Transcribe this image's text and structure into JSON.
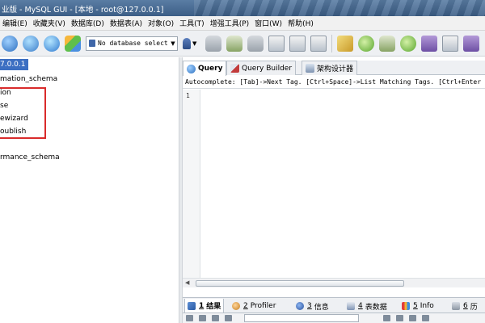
{
  "window": {
    "title": "业版 - MySQL GUI - [本地 - root@127.0.0.1]"
  },
  "menu": {
    "items": [
      "编辑(E)",
      "收藏夹(V)",
      "数据库(D)",
      "数据表(A)",
      "对象(O)",
      "工具(T)",
      "增强工具(P)",
      "窗口(W)",
      "帮助(H)"
    ]
  },
  "toolbar": {
    "database_select": "No database select"
  },
  "tree": {
    "root_label": "7.0.0.1",
    "items": [
      "mation_schema",
      "ion",
      "se",
      "ewizard",
      "oublish",
      "rmance_schema"
    ],
    "highlight_color": "#d92b2b",
    "selection_color": "#3c6fc2"
  },
  "editor": {
    "tabs": [
      "Query",
      "Query Builder",
      "架构设计器"
    ],
    "autocomplete_hint": "Autocomplete: [Tab]->Next Tag. [Ctrl+Space]->List Matching Tags. [Ctrl+Enter",
    "line_numbers": [
      "1"
    ]
  },
  "results": {
    "tabs": [
      {
        "num": "1",
        "label": "结果"
      },
      {
        "num": "2",
        "label": "Profiler"
      },
      {
        "num": "3",
        "label": "信息"
      },
      {
        "num": "4",
        "label": "表数据"
      },
      {
        "num": "5",
        "label": "Info"
      },
      {
        "num": "6",
        "label": "历"
      }
    ]
  }
}
